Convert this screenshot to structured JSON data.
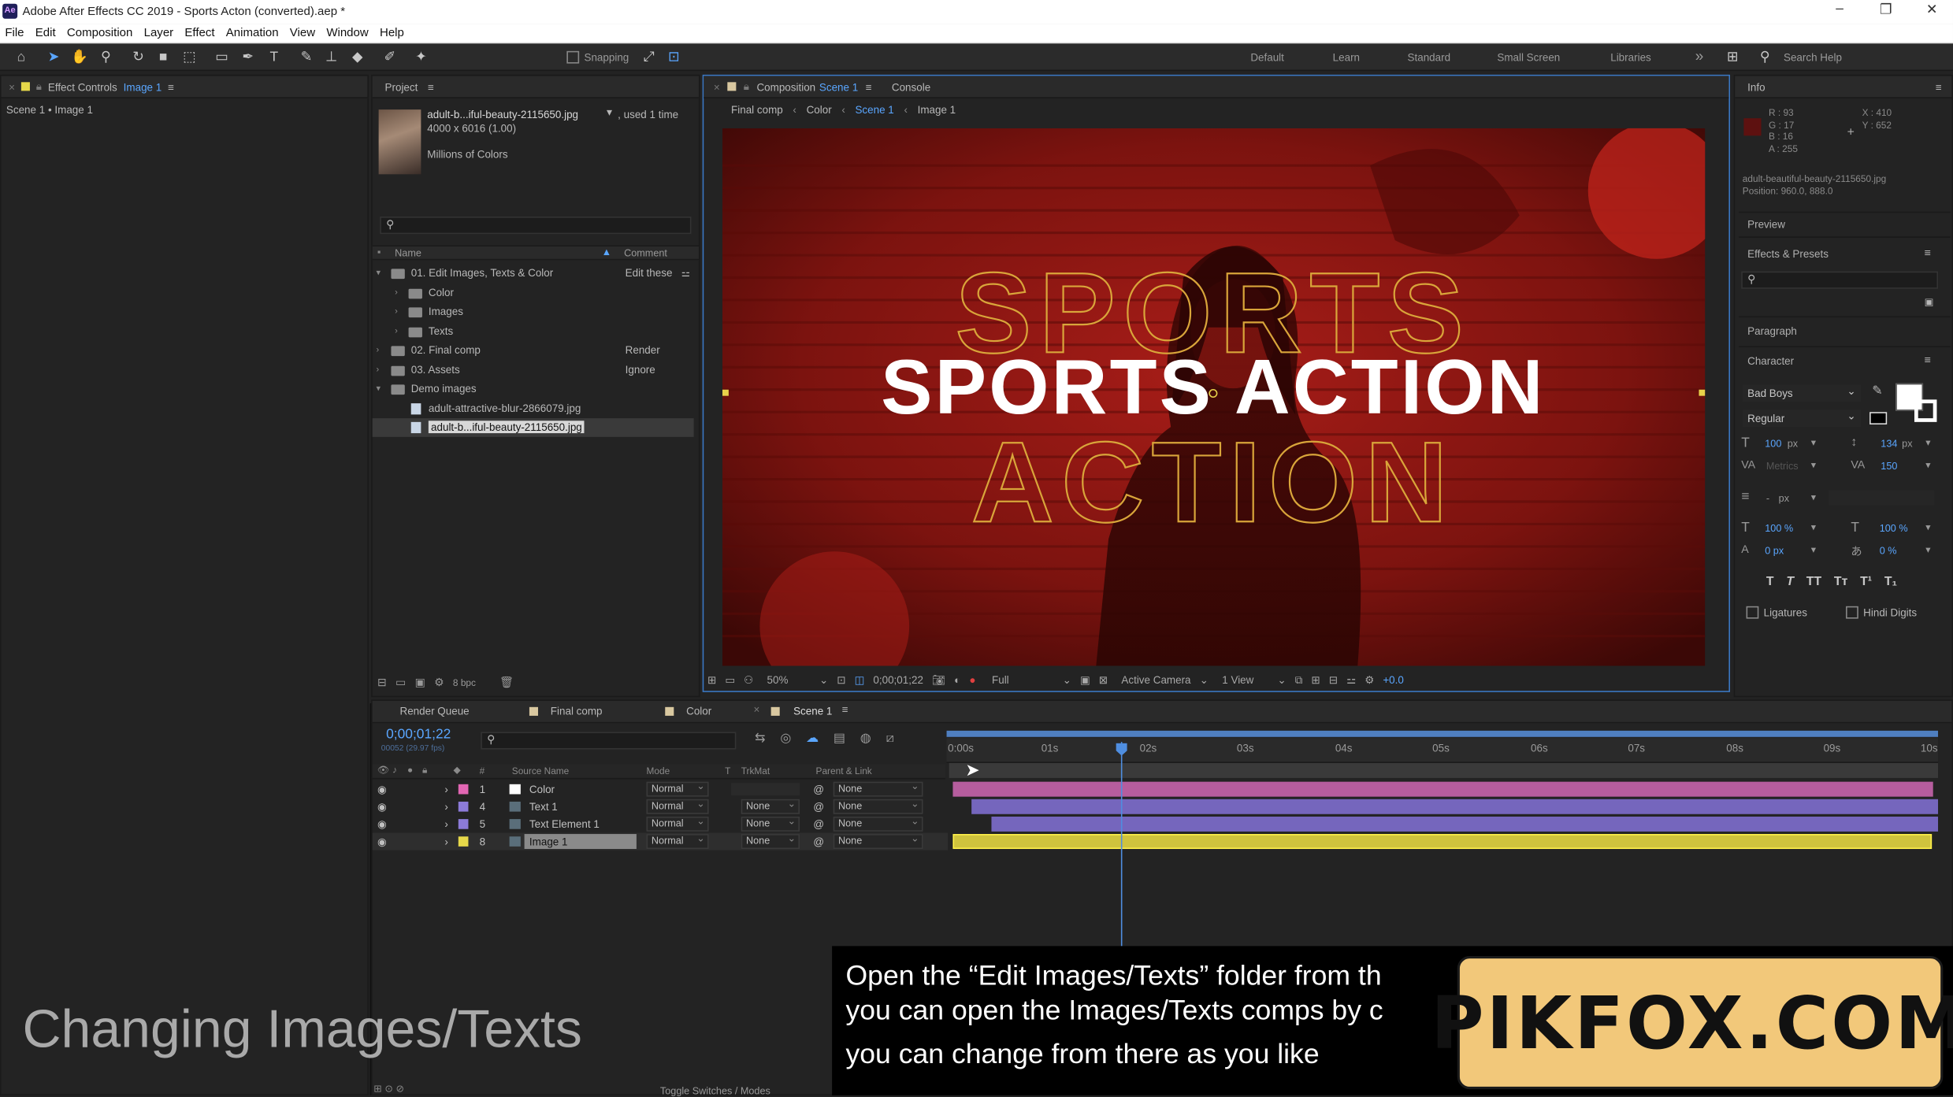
{
  "window": {
    "title": "Adobe After Effects CC 2019 - Sports Acton (converted).aep *",
    "app_icon": "Ae"
  },
  "menu": [
    "File",
    "Edit",
    "Composition",
    "Layer",
    "Effect",
    "Animation",
    "View",
    "Window",
    "Help"
  ],
  "toolbar": {
    "snapping_label": "Snapping",
    "workspaces": [
      "Default",
      "Learn",
      "Standard",
      "Small Screen",
      "Libraries"
    ],
    "more": "»",
    "search_placeholder": "Search Help"
  },
  "effect_controls": {
    "tab_prefix": "Effect Controls",
    "tab_item": "Image 1",
    "breadcrumb": "Scene 1 • Image 1"
  },
  "project": {
    "tab": "Project",
    "selected_file": "adult-b...iful-beauty-2115650.jpg",
    "used": ", used 1 time",
    "dimensions": "4000 x 6016 (1.00)",
    "colors": "Millions of Colors",
    "col_name": "Name",
    "col_comment": "Comment",
    "items": [
      {
        "label": "01. Edit Images, Texts & Color",
        "comment": "Edit these",
        "indent": 0,
        "open": true,
        "type": "folder"
      },
      {
        "label": "Color",
        "comment": "",
        "indent": 1,
        "open": false,
        "type": "folder"
      },
      {
        "label": "Images",
        "comment": "",
        "indent": 1,
        "open": false,
        "type": "folder"
      },
      {
        "label": "Texts",
        "comment": "",
        "indent": 1,
        "open": false,
        "type": "folder"
      },
      {
        "label": "02. Final comp",
        "comment": "Render",
        "indent": 0,
        "open": false,
        "type": "folder"
      },
      {
        "label": "03. Assets",
        "comment": "Ignore",
        "indent": 0,
        "open": false,
        "type": "folder"
      },
      {
        "label": "Demo images",
        "comment": "",
        "indent": 0,
        "open": true,
        "type": "folder"
      },
      {
        "label": "adult-attractive-blur-2866079.jpg",
        "comment": "",
        "indent": 1,
        "open": false,
        "type": "file"
      },
      {
        "label": "adult-b...iful-beauty-2115650.jpg",
        "comment": "",
        "indent": 1,
        "open": false,
        "type": "file",
        "selected": true
      }
    ],
    "bpc": "8 bpc"
  },
  "composition": {
    "tab_prefix": "Composition",
    "tab_item": "Scene 1",
    "tab_console": "Console",
    "breadcrumbs": [
      "Final comp",
      "Color",
      "Scene 1",
      "Image 1"
    ],
    "headline": "SPORTS ACTION",
    "outline_top": "SPORTS",
    "outline_bottom": "ACTION",
    "zoom": "50%",
    "timecode": "0;00;01;22",
    "resolution": "Full",
    "camera": "Active Camera",
    "views": "1 View",
    "exposure": "+0.0"
  },
  "info": {
    "tab": "Info",
    "r": "R : 93",
    "g": "G : 17",
    "b": "B : 16",
    "a": "A : 255",
    "x": "X : 410",
    "y": "Y : 652",
    "file": "adult-beautiful-beauty-2115650.jpg",
    "position": "Position: 960.0, 888.0",
    "swatch_color": "#5d1110"
  },
  "right_sections": {
    "preview": "Preview",
    "effects": "Effects & Presets",
    "paragraph": "Paragraph",
    "character": "Character",
    "font": "Bad Boys",
    "style": "Regular",
    "size": "100",
    "size_unit": "px",
    "leading": "134",
    "leading_unit": "px",
    "kerning": "Metrics",
    "tracking": "150",
    "stroke": "-",
    "stroke_unit": "px",
    "vscale": "100 %",
    "hscale": "100 %",
    "baseline": "0 px",
    "tsume": "0 %",
    "ligatures": "Ligatures",
    "hindi": "Hindi Digits"
  },
  "timeline": {
    "tabs": [
      "Render Queue",
      "Final comp",
      "Color",
      "Scene 1"
    ],
    "timecode": "0;00;01;22",
    "frames": "00052 (29.97 fps)",
    "col_source": "Source Name",
    "col_mode": "Mode",
    "col_t": "T",
    "col_trkmat": "TrkMat",
    "col_parent": "Parent & Link",
    "ticks": [
      "0:00s",
      "01s",
      "02s",
      "03s",
      "04s",
      "05s",
      "06s",
      "07s",
      "08s",
      "09s",
      "10s"
    ],
    "layers": [
      {
        "num": "1",
        "name": "Color",
        "mode": "Normal",
        "trkmat": "",
        "parent": "None",
        "label_color": "#e266b3",
        "bar_color": "#b65d9e"
      },
      {
        "num": "4",
        "name": "Text 1",
        "mode": "Normal",
        "trkmat": "None",
        "parent": "None",
        "label_color": "#8c7bd9",
        "bar_color": "#7566bd"
      },
      {
        "num": "5",
        "name": "Text Element 1",
        "mode": "Normal",
        "trkmat": "None",
        "parent": "None",
        "label_color": "#8c7bd9",
        "bar_color": "#7566bd"
      },
      {
        "num": "8",
        "name": "Image 1",
        "mode": "Normal",
        "trkmat": "None",
        "parent": "None",
        "label_color": "#e6d84a",
        "bar_color": "#cfc33d"
      }
    ],
    "toggle": "Toggle Switches / Modes"
  },
  "overlay": {
    "title": "Changing Images/Texts",
    "caption_lines": [
      "Open the “Edit Images/Texts” folder from th",
      "you can open the Images/Texts comps by c",
      "you can change from there as you like"
    ],
    "watermark": "PIKFOX.COM"
  }
}
